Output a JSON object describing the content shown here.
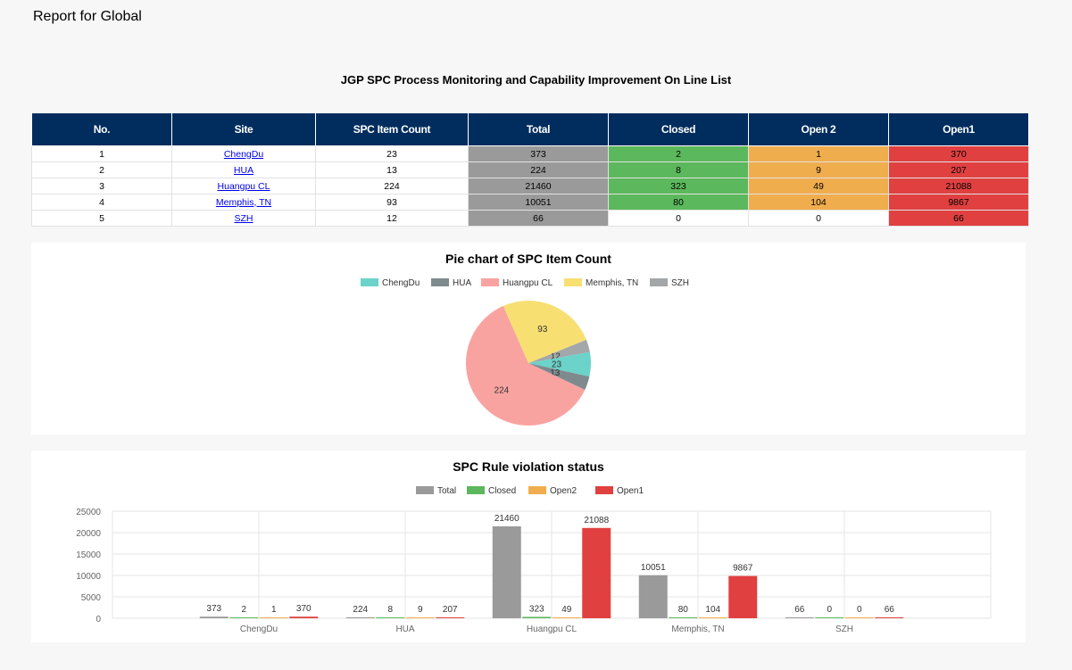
{
  "page": {
    "title": "Report for Global"
  },
  "list": {
    "title": "JGP SPC Process Monitoring and Capability Improvement On Line List"
  },
  "table": {
    "headers": [
      "No.",
      "Site",
      "SPC Item Count",
      "Total",
      "Closed",
      "Open 2",
      "Open1"
    ],
    "rows": [
      {
        "no": "1",
        "site": "ChengDu",
        "count": "23",
        "total": "373",
        "closed": "2",
        "open2": "1",
        "open1": "370",
        "closed_color": "green",
        "open2_color": "orange"
      },
      {
        "no": "2",
        "site": "HUA",
        "count": "13",
        "total": "224",
        "closed": "8",
        "open2": "9",
        "open1": "207",
        "closed_color": "green",
        "open2_color": "orange"
      },
      {
        "no": "3",
        "site": "Huangpu CL",
        "count": "224",
        "total": "21460",
        "closed": "323",
        "open2": "49",
        "open1": "21088",
        "closed_color": "green",
        "open2_color": "orange"
      },
      {
        "no": "4",
        "site": "Memphis, TN",
        "count": "93",
        "total": "10051",
        "closed": "80",
        "open2": "104",
        "open1": "9867",
        "closed_color": "green",
        "open2_color": "orange"
      },
      {
        "no": "5",
        "site": "SZH",
        "count": "12",
        "total": "66",
        "closed": "0",
        "open2": "0",
        "open1": "66",
        "closed_color": "white",
        "open2_color": "white"
      }
    ]
  },
  "colors": {
    "header_bg": "#012d5e",
    "total": "#9a9a9a",
    "closed": "#5cb85c",
    "open2": "#f0ad4e",
    "open1": "#e04040"
  },
  "chart_data": [
    {
      "type": "pie",
      "title": "Pie chart of SPC Item Count",
      "legend_position": "top",
      "categories": [
        "ChengDu",
        "HUA",
        "Huangpu CL",
        "Memphis, TN",
        "SZH"
      ],
      "values": [
        23,
        13,
        224,
        93,
        12
      ],
      "colors": [
        "#6bd3c9",
        "#7f8a8f",
        "#f9a3a1",
        "#f7df72",
        "#a3a7a9"
      ]
    },
    {
      "type": "bar",
      "title": "SPC Rule violation status",
      "legend_position": "top",
      "categories": [
        "ChengDu",
        "HUA",
        "Huangpu CL",
        "Memphis, TN",
        "SZH"
      ],
      "series": [
        {
          "name": "Total",
          "values": [
            373,
            224,
            21460,
            10051,
            66
          ],
          "color": "#9a9a9a"
        },
        {
          "name": "Closed",
          "values": [
            2,
            8,
            323,
            80,
            0
          ],
          "color": "#5cb85c"
        },
        {
          "name": "Open2",
          "values": [
            1,
            9,
            49,
            104,
            0
          ],
          "color": "#f0ad4e"
        },
        {
          "name": "Open1",
          "values": [
            370,
            207,
            21088,
            9867,
            66
          ],
          "color": "#e04040"
        }
      ],
      "ylim": [
        0,
        25000
      ],
      "yticks": [
        0,
        5000,
        10000,
        15000,
        20000,
        25000
      ],
      "grid": true
    }
  ]
}
